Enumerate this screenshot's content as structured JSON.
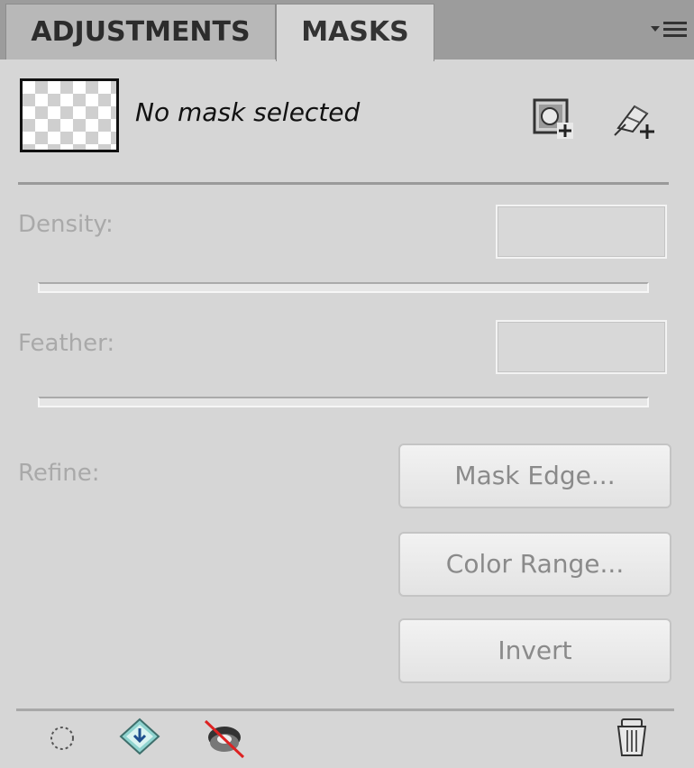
{
  "tabs": [
    {
      "label": "ADJUSTMENTS",
      "active": false
    },
    {
      "label": "MASKS",
      "active": true
    }
  ],
  "header": {
    "status": "No mask selected"
  },
  "density": {
    "label": "Density:",
    "value": ""
  },
  "feather": {
    "label": "Feather:",
    "value": ""
  },
  "refine": {
    "label": "Refine:",
    "mask_edge": "Mask Edge...",
    "color_range": "Color Range...",
    "invert": "Invert"
  },
  "icons": {
    "panel_menu": "panel-menu-icon",
    "add_pixel_mask": "add-pixel-mask-icon",
    "add_vector_mask": "add-vector-mask-icon",
    "load_selection": "load-selection-icon",
    "apply_mask": "apply-mask-icon",
    "disable_mask": "disable-mask-icon",
    "delete": "trash-icon"
  },
  "colors": {
    "panel_bg": "#d6d6d6",
    "tab_bar": "#9c9c9c",
    "disabled_text": "#a9a9a9"
  }
}
